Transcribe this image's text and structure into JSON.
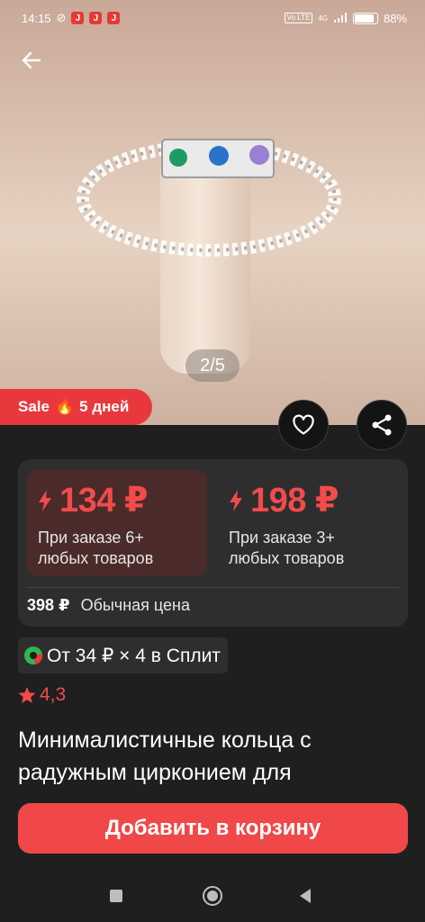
{
  "status_bar": {
    "time": "14:15",
    "app_icon_letter": "J",
    "volte_label": "Vo LTE",
    "network_label": "4G",
    "battery": "88%",
    "battery_level": 0.88
  },
  "gallery": {
    "indicator": "2/5"
  },
  "sale_badge": {
    "label": "Sale",
    "emoji": "🔥",
    "duration": "5 дней"
  },
  "prices": {
    "tiers": [
      {
        "price": "134 ₽",
        "condition": "При заказе 6+ любых товаров"
      },
      {
        "price": "198 ₽",
        "condition": "При заказе 3+ любых товаров"
      }
    ],
    "regular_price": "398 ₽",
    "regular_label": "Обычная цена"
  },
  "split": {
    "text": "От 34 ₽ × 4 в Сплит"
  },
  "rating": {
    "value": "4,3"
  },
  "product": {
    "title": "Минималистичные кольца с радужным цирконием для"
  },
  "cart_button": {
    "label": "Добавить в корзину"
  },
  "colors": {
    "accent": "#f04848",
    "background": "#1f1f1f",
    "card": "#2e2e2e"
  }
}
